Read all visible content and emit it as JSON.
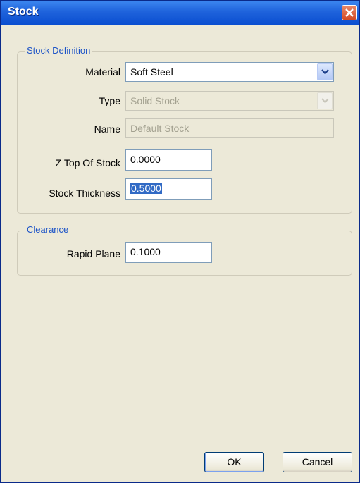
{
  "window": {
    "title": "Stock"
  },
  "stock_definition": {
    "legend": "Stock Definition",
    "material": {
      "label": "Material",
      "value": "Soft Steel"
    },
    "type": {
      "label": "Type",
      "value": "Solid Stock"
    },
    "name": {
      "label": "Name",
      "value": "Default Stock"
    },
    "z_top": {
      "label": "Z Top Of Stock",
      "value": "0.0000"
    },
    "thickness": {
      "label": "Stock Thickness",
      "value": "0.5000"
    }
  },
  "clearance": {
    "legend": "Clearance",
    "rapid_plane": {
      "label": "Rapid Plane",
      "value": "0.1000"
    }
  },
  "buttons": {
    "ok": "OK",
    "cancel": "Cancel"
  },
  "colors": {
    "titlebar": "#1f63dc",
    "close": "#d44a25",
    "legend_text": "#1d54c7",
    "dialog_bg": "#ece9d8",
    "selection": "#316ac5"
  }
}
